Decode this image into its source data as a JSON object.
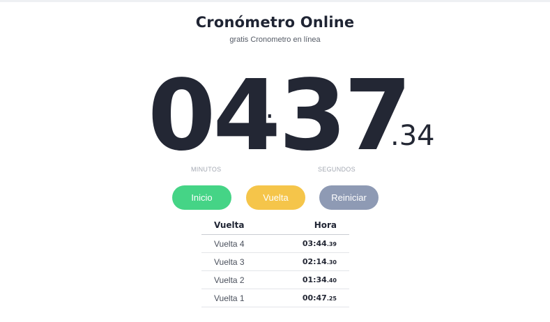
{
  "header": {
    "title": "Cronómetro Online",
    "subtitle": "gratis Cronometro en línea"
  },
  "timer": {
    "minutes": "04",
    "separator": ":",
    "seconds": "37",
    "hundredths": ".34",
    "minutes_label": "MINUTOS",
    "seconds_label": "SEGUNDOS"
  },
  "controls": {
    "start_label": "Inicio",
    "lap_label": "Vuelta",
    "reset_label": "Reiniciar"
  },
  "laps": {
    "headers": {
      "lap": "Vuelta",
      "time": "Hora"
    },
    "rows": [
      {
        "name": "Vuelta 4",
        "time": "03:44",
        "ms": ".39"
      },
      {
        "name": "Vuelta 3",
        "time": "02:14",
        "ms": ".30"
      },
      {
        "name": "Vuelta 2",
        "time": "01:34",
        "ms": ".40"
      },
      {
        "name": "Vuelta 1",
        "time": "00:47",
        "ms": ".25"
      }
    ]
  },
  "colors": {
    "start": "#45d486",
    "lap": "#f5c54a",
    "reset": "#8e9ab4",
    "text": "#232734"
  }
}
